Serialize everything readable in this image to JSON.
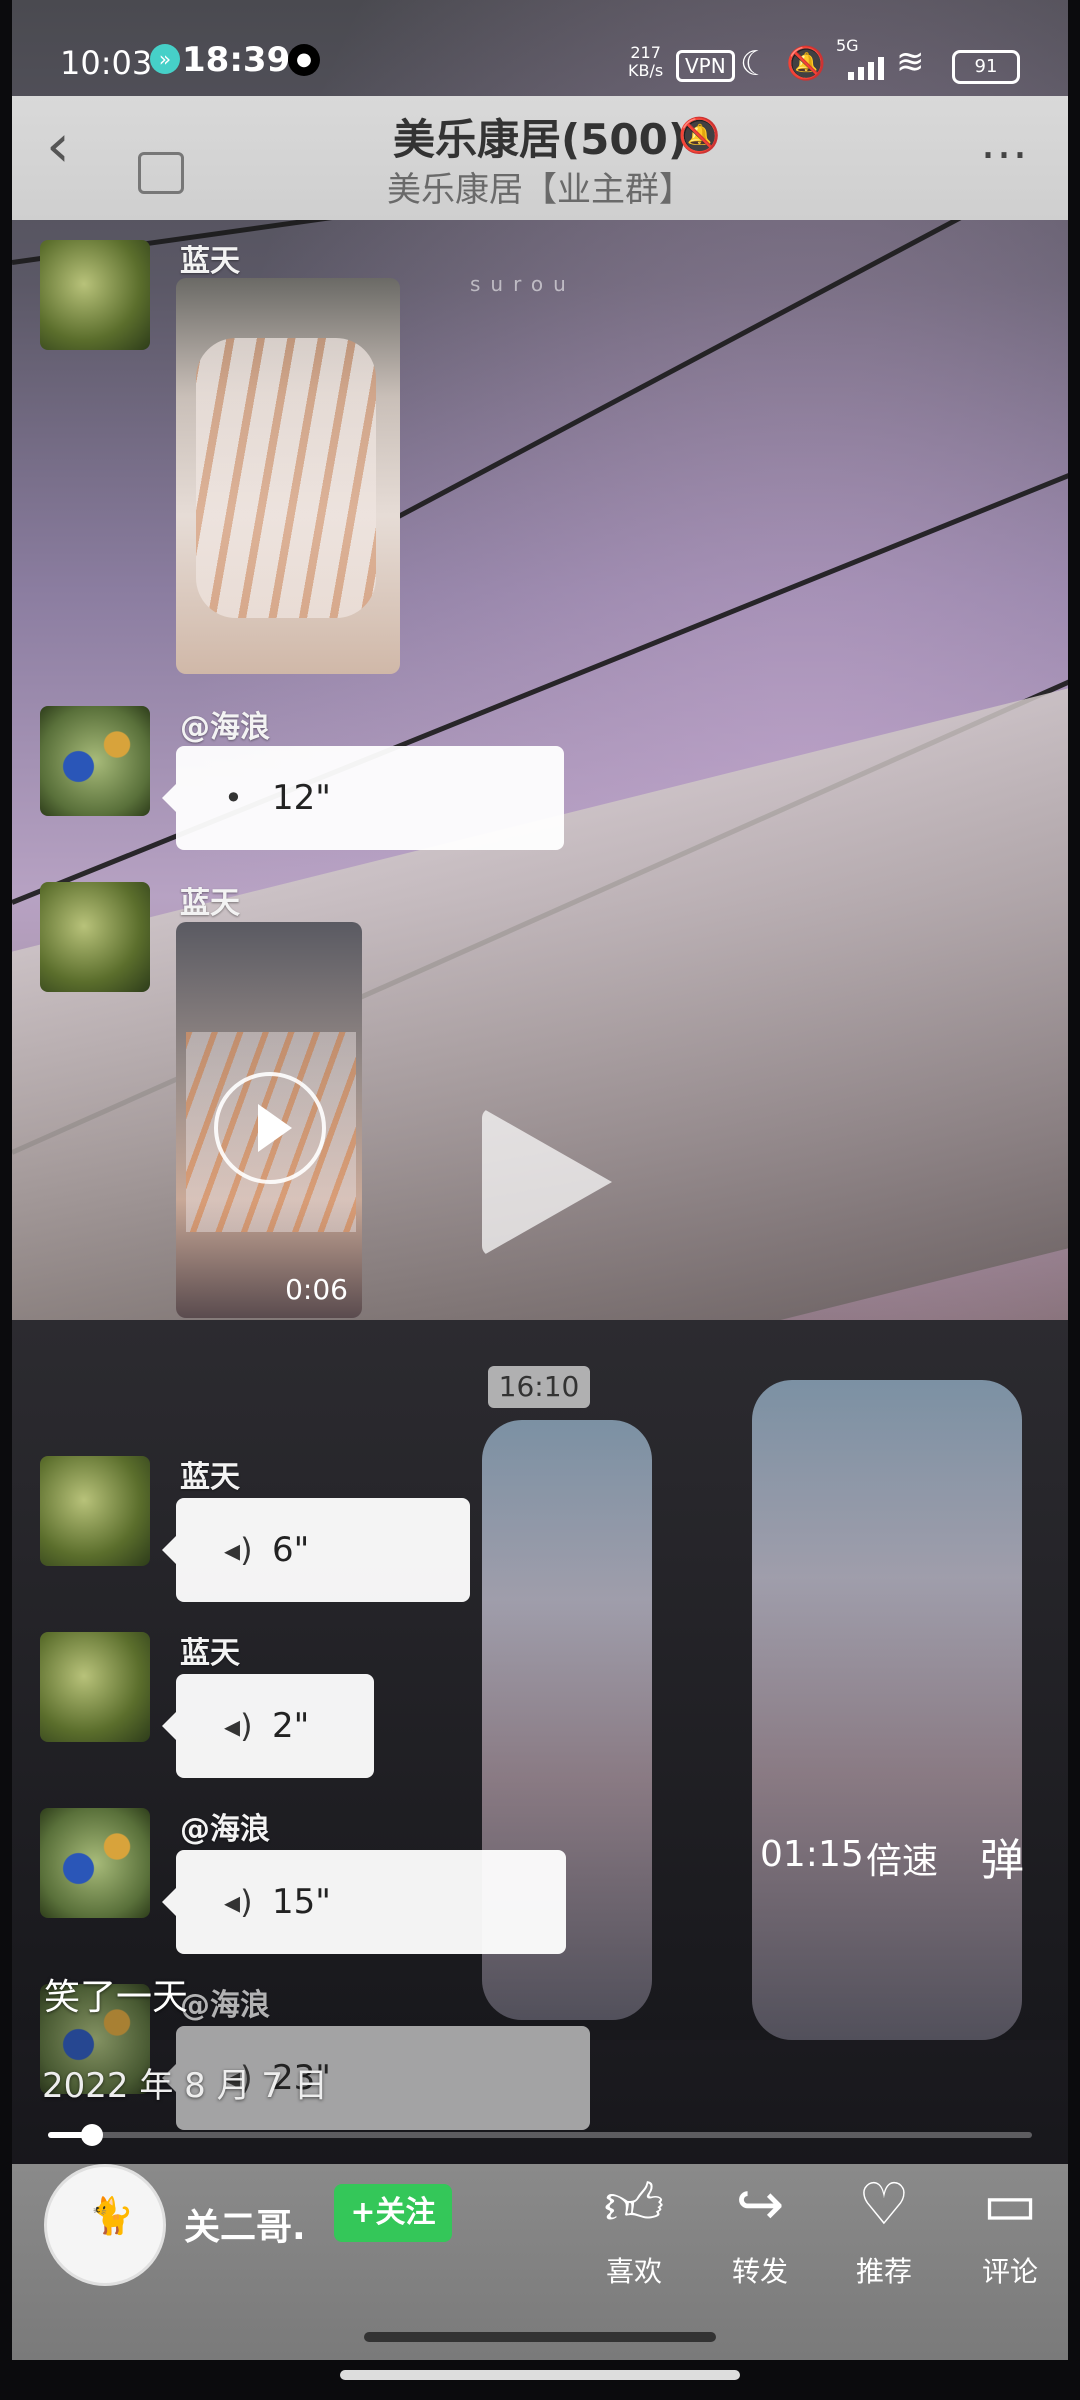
{
  "status_bar": {
    "time": "10:03",
    "overlay_time": "18:39",
    "net_speed_value": "217",
    "net_speed_unit": "KB/s",
    "vpn": "VPN",
    "network": "5G",
    "battery": "91"
  },
  "chat_header": {
    "title": "美乐康居(500)",
    "subtitle": "美乐康居【业主群】"
  },
  "watermark": "surou",
  "messages": [
    {
      "sender": "蓝天",
      "type": "image"
    },
    {
      "sender": "@海浪",
      "type": "voice",
      "duration": "12\""
    },
    {
      "sender": "蓝天",
      "type": "video",
      "duration": "0:06"
    },
    {
      "sender": "蓝天",
      "type": "voice",
      "duration": "6\""
    },
    {
      "sender": "蓝天",
      "type": "voice",
      "duration": "2\""
    },
    {
      "sender": "@海浪",
      "type": "voice",
      "duration": "15\""
    },
    {
      "sender": "@海浪",
      "type": "voice",
      "duration": "23\""
    }
  ],
  "chat_time_divider": "16:10",
  "player": {
    "current_time": "01:15",
    "speed_label": "倍速",
    "danmu_label": "弹",
    "progress": 0.045
  },
  "post": {
    "title": "笑了一天",
    "date": "2022 年 8 月 7 日"
  },
  "author": {
    "name": "关二哥.",
    "follow_label": "+关注"
  },
  "actions": [
    {
      "label": "喜欢",
      "icon": "thumbs-up-icon"
    },
    {
      "label": "转发",
      "icon": "share-icon"
    },
    {
      "label": "推荐",
      "icon": "heart-icon"
    },
    {
      "label": "评论",
      "icon": "comment-icon"
    }
  ]
}
